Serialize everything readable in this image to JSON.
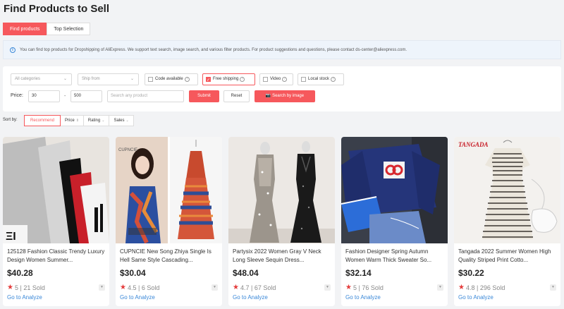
{
  "page": {
    "title": "Find Products to Sell"
  },
  "tabs": [
    {
      "label": "Find products",
      "active": true
    },
    {
      "label": "Top Selection",
      "active": false
    }
  ],
  "info": {
    "text": "You can find top products for Dropshipping of AliExpress. We support text search, image search, and various filter products. For product suggestions and questions, please contact ds-center@aliexpress.com."
  },
  "filters": {
    "category": "All categories",
    "ship_from": "Ship from",
    "code_available": "Code available",
    "free_shipping": "Free shipping",
    "video": "Video",
    "local_stock": "Local stock",
    "price_label": "Price:",
    "price_min": "30",
    "price_sep": "-",
    "price_max": "500",
    "search_placeholder": "Search any product",
    "submit": "Submit",
    "reset": "Reset",
    "search_image": "Search by image"
  },
  "sort": {
    "label": "Sort by:",
    "options": [
      "Recommend",
      "Price",
      "Rating",
      "Sales"
    ]
  },
  "products": [
    {
      "title": "125128 Fashion Classic Trendy Luxury Design Women Summer...",
      "price": "$40.28",
      "rating": "5",
      "sold": "21 Sold",
      "analyze": "Go to Analyze"
    },
    {
      "title": "CUPNCIE New Song Zhiya Single Is Hell Same Style Cascading...",
      "price": "$30.04",
      "rating": "4.5",
      "sold": "6 Sold",
      "analyze": "Go to Analyze"
    },
    {
      "title": "Partysix 2022 Women Gray V Neck Long Sleeve Sequin Dress...",
      "price": "$48.04",
      "rating": "4.7",
      "sold": "67 Sold",
      "analyze": "Go to Analyze"
    },
    {
      "title": "Fashion Designer Spring Autumn Women Warm Thick Sweater So...",
      "price": "$32.14",
      "rating": "5",
      "sold": "76 Sold",
      "analyze": "Go to Analyze"
    },
    {
      "title": "Tangada 2022 Summer Women High Quality Striped Print Cotto...",
      "price": "$30.22",
      "rating": "4.8",
      "sold": "296 Sold",
      "analyze": "Go to Analyze"
    }
  ],
  "image_texts": {
    "cupncie": "CUPNCIE",
    "tangada": "TANGADA"
  },
  "colors": {
    "accent": "#f6585c",
    "link": "#3a88d8",
    "star": "#e43b3b"
  }
}
